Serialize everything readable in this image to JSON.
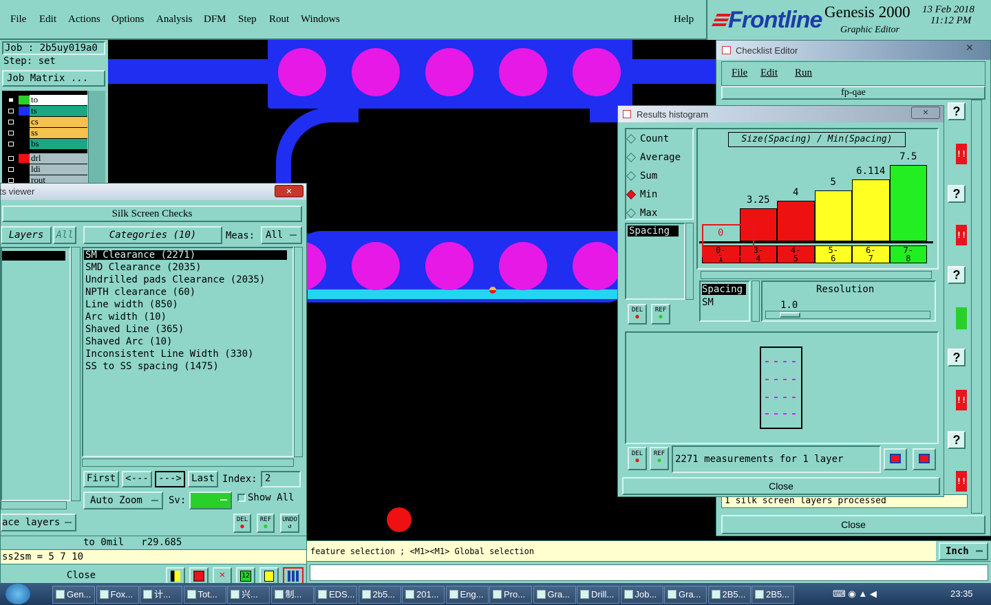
{
  "menubar": {
    "items": [
      "File",
      "Edit",
      "Actions",
      "Options",
      "Analysis",
      "DFM",
      "Step",
      "Rout",
      "Windows"
    ],
    "help": "Help"
  },
  "brand": {
    "logo": "Frontline",
    "product": "Genesis 2000",
    "subtitle": "Graphic Editor",
    "date": "13 Feb 2018",
    "time": "11:12 PM"
  },
  "job": {
    "job_label": "Job : 2b5uy019a0",
    "step_label": "Step: set",
    "matrix_button": "Job Matrix ..."
  },
  "layers": [
    {
      "name": "to",
      "color": "#2ad02a",
      "bg": "#ffffff"
    },
    {
      "name": "ts",
      "color": "#1f2ef0",
      "bg": "#1aa882"
    },
    {
      "name": "cs",
      "color": "",
      "bg": "#f5c24e"
    },
    {
      "name": "ss",
      "color": "",
      "bg": "#f5c24e"
    },
    {
      "name": "bs",
      "color": "",
      "bg": "#1aa882"
    },
    {
      "name": "drl",
      "color": "#ee1111",
      "bg": "#a8bfc4"
    },
    {
      "name": "ldi",
      "color": "",
      "bg": "#a8bfc4"
    },
    {
      "name": "rout",
      "color": "",
      "bg": "#a8bfc4"
    }
  ],
  "viewer": {
    "title": "ts viewer",
    "heading": "Silk Screen Checks",
    "layers_tab": "Layers",
    "layers_all": "All",
    "categories_tab": "Categories (10)",
    "meas_label": "Meas:",
    "meas_value": "All",
    "categories": [
      "SM Clearance (2271)",
      "SMD Clearance (2035)",
      "Undrilled pads Clearance (2035)",
      "NPTH clearance (60)",
      "Line width (850)",
      "Arc width (10)",
      "Shaved Line (365)",
      "Shaved Arc (10)",
      "Inconsistent Line Width (330)",
      "SS to SS spacing (1475)"
    ],
    "first": "First",
    "prev": "<---",
    "next": "--->",
    "last": "Last",
    "index_label": "Index:",
    "index_value": "2",
    "auto_zoom": "Auto Zoom",
    "sv_label": "Sv:",
    "show_all": "Show All",
    "surface_layers": "ace layers",
    "status_line": "to 0mil   r29.685",
    "ss2sm": "ss2sm = 5 7 10",
    "close": "Close",
    "del": "DEL",
    "ref": "REF",
    "undo": "UNDO"
  },
  "histogram": {
    "title": "Results histogram",
    "modes": [
      "Count",
      "Average",
      "Sum",
      "Min",
      "Max"
    ],
    "selected_mode": "Min",
    "list_item": "Spacing",
    "chart_title": "Size(Spacing) / Min(Spacing)",
    "resolution_label": "Resolution",
    "resolution_value": "1.0",
    "spacing_tab": "Spacing",
    "sm_tab": "SM",
    "status": "2271 measurements for 1 layer",
    "close": "Close",
    "del": "DEL",
    "ref": "REF"
  },
  "chart_data": {
    "type": "bar",
    "title": "Size(Spacing) / Min(Spacing)",
    "categories": [
      "0-1",
      "3-4",
      "4-5",
      "5-6",
      "6-7",
      "7-8"
    ],
    "values": [
      0,
      3.25,
      4,
      5,
      6.114,
      7.5
    ],
    "value_labels": [
      "0",
      "3.25",
      "4",
      "5",
      "6.114",
      "7.5"
    ],
    "colors": [
      "#ee1111",
      "#ee1111",
      "#ee1111",
      "#ffff22",
      "#ffff22",
      "#22ee22"
    ],
    "ylim": [
      0,
      7.5
    ],
    "grid": false
  },
  "checklist": {
    "title": "Checklist Editor",
    "menu": [
      "File",
      "Edit",
      "Run"
    ],
    "name": "fp-qae",
    "processed_text": "1 silk screen layers processed",
    "close": "Close"
  },
  "prompt_line": "feature selection ; <M1><M1> Global selection",
  "units": "Inch",
  "taskbar": {
    "items": [
      "Gen...",
      "Fox...",
      "计...",
      "Tot...",
      "兴...",
      "制...",
      "EDS...",
      "2b5...",
      "201...",
      "Eng...",
      "Pro...",
      "Gra...",
      "Drill...",
      "Job...",
      "Gra...",
      "2B5...",
      "2B5..."
    ],
    "clock": "23:35"
  },
  "colors": {
    "panel": "#8fd6c8",
    "copper": "#1f2ef0",
    "pad": "#e619e6",
    "silk": "#22d6f0",
    "drill": "#ee1111"
  }
}
